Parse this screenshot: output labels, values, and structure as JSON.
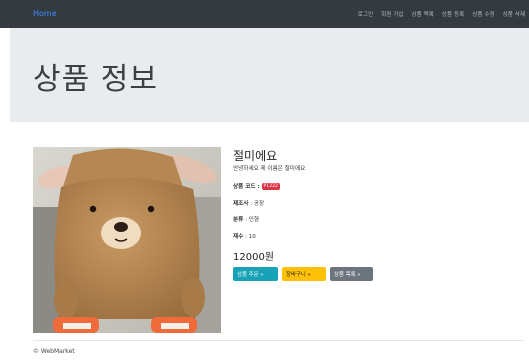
{
  "navbar": {
    "brand": "Home",
    "links": [
      "로그인",
      "회원 가입",
      "상품 목록",
      "상품 등록",
      "상품 수정",
      "상품 삭제"
    ]
  },
  "jumbotron": {
    "title": "상품 정보"
  },
  "product": {
    "name": "절미에요",
    "description": "안녕하세요 제 이름은 절미에요",
    "code_label": "상품 코드 :",
    "code_value": "P1222",
    "maker_label": "제조사",
    "maker_value": ": 공장",
    "category_label": "분류",
    "category_value": ": 인형",
    "stock_label": "재수",
    "stock_value": ": 10",
    "price": "12000원"
  },
  "buttons": {
    "order": "상품 주문 »",
    "cart": "장바구니 »",
    "list": "상품 목록 »"
  },
  "footer": {
    "copyright": "© WebMarket"
  },
  "colors": {
    "navbar": "#343a40",
    "brand": "#3b8dff",
    "jumbotron": "#e9ecef",
    "badge": "#dc3545",
    "btn_info": "#17a2b8",
    "btn_warning": "#ffc107",
    "btn_secondary": "#6c757d"
  }
}
